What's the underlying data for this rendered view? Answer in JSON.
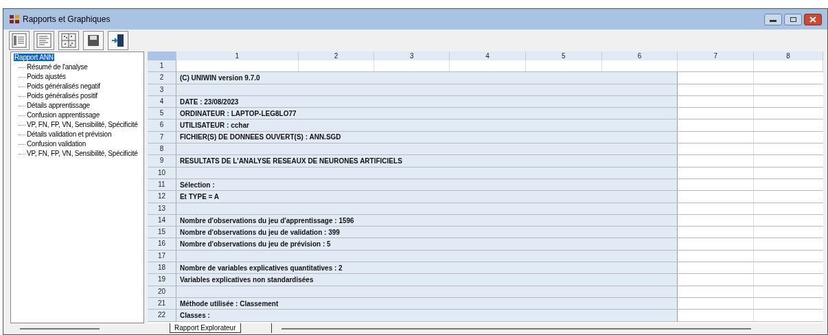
{
  "window": {
    "title": "Rapports et Graphiques"
  },
  "toolbar": [
    {
      "kind": "list"
    },
    {
      "kind": "text"
    },
    {
      "kind": "scatter"
    },
    {
      "kind": "save"
    },
    {
      "kind": "exit"
    }
  ],
  "tree": {
    "label": "Rapport ANN",
    "selected": true,
    "children": [
      {
        "label": "Résumé de l'analyse",
        "selected": false
      },
      {
        "label": "Poids ajustés",
        "selected": false
      },
      {
        "label": "Poids généralisés negatif",
        "selected": false
      },
      {
        "label": "Poids généralisés positif",
        "selected": false
      },
      {
        "label": "Détails apprentissage",
        "selected": false
      },
      {
        "label": "Confusion apprentissage",
        "selected": false
      },
      {
        "label": "VP, FN, FP, VN, Sensibilité, Spécificité",
        "selected": false
      },
      {
        "label": "Détails validation et prévision",
        "selected": false
      },
      {
        "label": "Confusion validation",
        "selected": false
      },
      {
        "label": "VP, FN, FP, VN, Sensibilité, Spécificité",
        "selected": false
      }
    ]
  },
  "grid": {
    "columns": [
      "1",
      "2",
      "3",
      "4",
      "5",
      "6",
      "7",
      "8"
    ],
    "rows": [
      {
        "number": "1",
        "merged": false
      },
      {
        "number": "2",
        "merged": true,
        "text": "(C) UNIWIN version 9.7.0"
      },
      {
        "number": "3",
        "merged": true
      },
      {
        "number": "4",
        "merged": true,
        "text": "DATE : 23/08/2023"
      },
      {
        "number": "5",
        "merged": true,
        "text": "ORDINATEUR : LAPTOP-LEG8LO77"
      },
      {
        "number": "6",
        "merged": true,
        "text": "UTILISATEUR : cchar"
      },
      {
        "number": "7",
        "merged": true,
        "text": "FICHIER(S) DE DONNEES OUVERT(S) : ANN.SGD"
      },
      {
        "number": "8",
        "merged": true
      },
      {
        "number": "9",
        "merged": true,
        "text": "RESULTATS DE L'ANALYSE RESEAUX DE NEURONES ARTIFICIELS"
      },
      {
        "number": "10",
        "merged": true
      },
      {
        "number": "11",
        "merged": true,
        "text": "Sélection :"
      },
      {
        "number": "12",
        "merged": true,
        "text": "Et TYPE = A"
      },
      {
        "number": "13",
        "merged": true
      },
      {
        "number": "14",
        "merged": true,
        "text": "Nombre d'observations du jeu d'apprentissage : 1596"
      },
      {
        "number": "15",
        "merged": true,
        "text": "Nombre d'observations du jeu de validation : 399"
      },
      {
        "number": "16",
        "merged": true,
        "text": "Nombre d'observations du jeu de prévision : 5"
      },
      {
        "number": "17",
        "merged": true
      },
      {
        "number": "18",
        "merged": true,
        "text": "Nombre de variables explicatives quantitatives : 2"
      },
      {
        "number": "19",
        "merged": true,
        "text": "Variables explicatives non standardisées"
      },
      {
        "number": "20",
        "merged": true
      },
      {
        "number": "21",
        "merged": true,
        "text": "Méthode utilisée : Classement"
      },
      {
        "number": "22",
        "merged": true,
        "text": "Classes :"
      }
    ]
  },
  "sheet_tabs": [
    {
      "label": "Rapport Explorateur",
      "selected": true
    }
  ]
}
